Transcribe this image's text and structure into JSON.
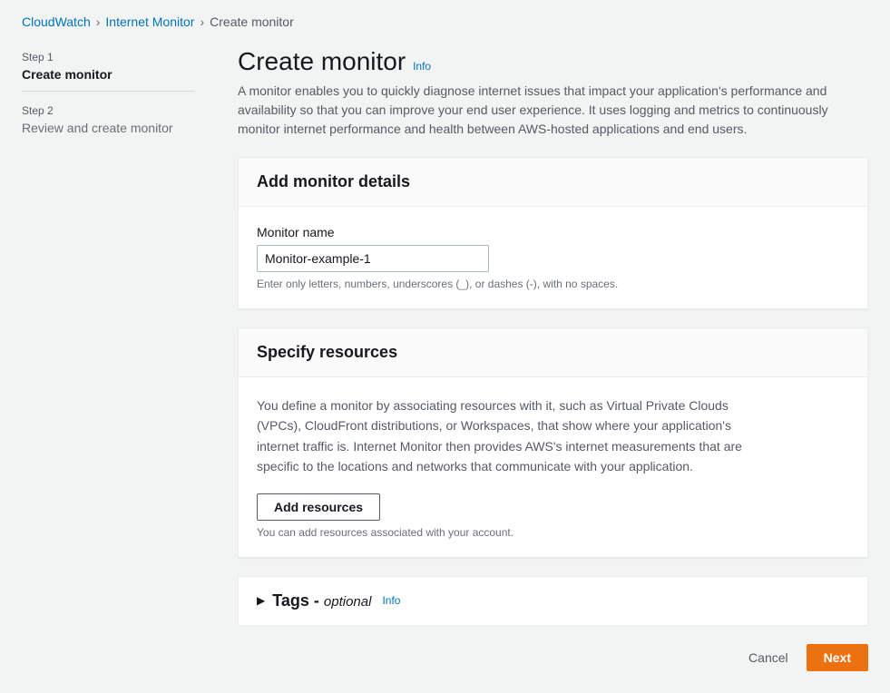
{
  "breadcrumbs": {
    "item1": "CloudWatch",
    "item2": "Internet Monitor",
    "item3": "Create monitor"
  },
  "sidebar": {
    "step1_label": "Step 1",
    "step1_title": "Create monitor",
    "step2_label": "Step 2",
    "step2_title": "Review and create monitor"
  },
  "header": {
    "title": "Create monitor",
    "info": "Info",
    "description": "A monitor enables you to quickly diagnose internet issues that impact your application's performance and availability so that you can improve your end user experience. It uses logging and metrics to continuously monitor internet performance and health between AWS-hosted applications and end users."
  },
  "monitor_details": {
    "heading": "Add monitor details",
    "name_label": "Monitor name",
    "name_value": "Monitor-example-1",
    "name_hint": "Enter only letters, numbers, underscores (_), or dashes (-), with no spaces."
  },
  "resources": {
    "heading": "Specify resources",
    "description": "You define a monitor by associating resources with it, such as Virtual Private Clouds (VPCs), CloudFront distributions, or Workspaces, that show where your application's internet traffic is. Internet Monitor then provides AWS's internet measurements that are specific to the locations and networks that communicate with your application.",
    "add_btn": "Add resources",
    "add_hint": "You can add resources associated with your account."
  },
  "tags": {
    "title_prefix": "Tags - ",
    "optional": "optional",
    "info": "Info"
  },
  "footer": {
    "cancel": "Cancel",
    "next": "Next"
  }
}
